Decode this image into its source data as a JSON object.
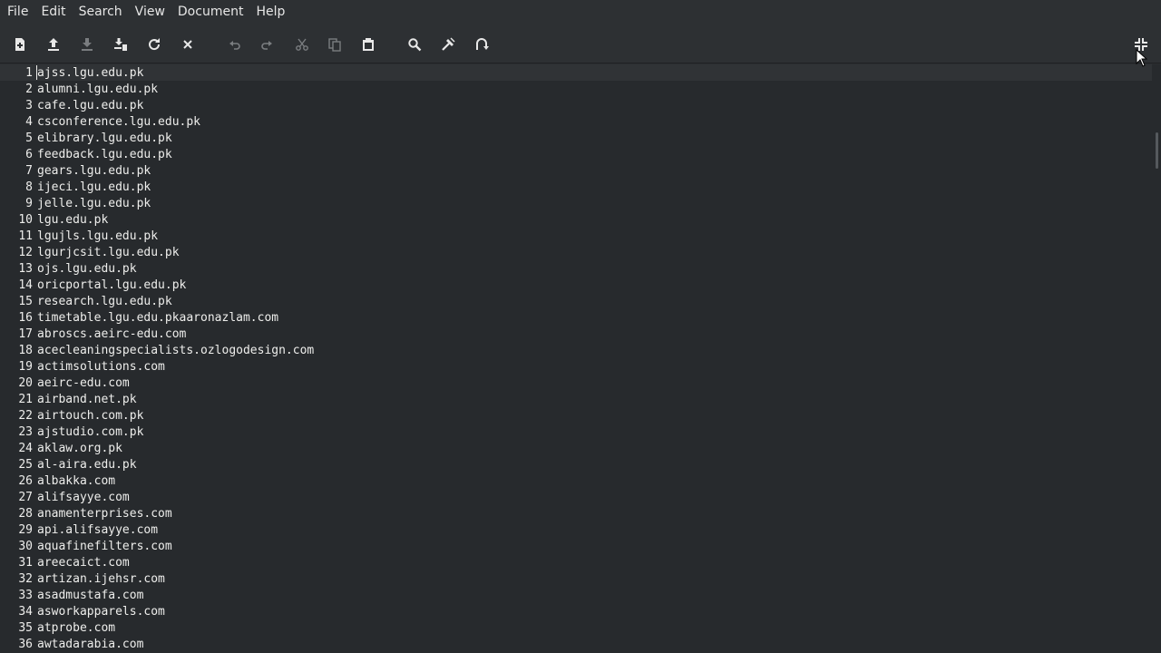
{
  "menubar": {
    "items": [
      "File",
      "Edit",
      "Search",
      "View",
      "Document",
      "Help"
    ]
  },
  "toolbar": {
    "buttons": [
      {
        "name": "new-document",
        "icon": "new-document-icon",
        "enabled": true
      },
      {
        "name": "open",
        "icon": "open-upload-icon",
        "enabled": true
      },
      {
        "name": "save",
        "icon": "save-download-icon",
        "enabled": false
      },
      {
        "name": "save-as",
        "icon": "save-as-icon",
        "enabled": true
      },
      {
        "name": "reload",
        "icon": "reload-icon",
        "enabled": true
      },
      {
        "name": "close",
        "icon": "close-icon",
        "enabled": true
      },
      {
        "name": "undo",
        "icon": "undo-icon",
        "enabled": false
      },
      {
        "name": "redo",
        "icon": "redo-icon",
        "enabled": false
      },
      {
        "name": "cut",
        "icon": "cut-icon",
        "enabled": false
      },
      {
        "name": "copy",
        "icon": "copy-icon",
        "enabled": false
      },
      {
        "name": "paste",
        "icon": "paste-icon",
        "enabled": true
      },
      {
        "name": "find",
        "icon": "search-icon",
        "enabled": true
      },
      {
        "name": "replace",
        "icon": "replace-icon",
        "enabled": true
      },
      {
        "name": "goto",
        "icon": "goto-icon",
        "enabled": true
      },
      {
        "name": "leave-fullscreen",
        "icon": "leave-fullscreen-icon",
        "enabled": true
      }
    ]
  },
  "editor": {
    "current_line": 1,
    "lines": [
      {
        "number": "1",
        "text": "ajss.lgu.edu.pk"
      },
      {
        "number": "2",
        "text": "alumni.lgu.edu.pk"
      },
      {
        "number": "3",
        "text": "cafe.lgu.edu.pk"
      },
      {
        "number": "4",
        "text": "csconference.lgu.edu.pk"
      },
      {
        "number": "5",
        "text": "elibrary.lgu.edu.pk"
      },
      {
        "number": "6",
        "text": "feedback.lgu.edu.pk"
      },
      {
        "number": "7",
        "text": "gears.lgu.edu.pk"
      },
      {
        "number": "8",
        "text": "ijeci.lgu.edu.pk"
      },
      {
        "number": "9",
        "text": "jelle.lgu.edu.pk"
      },
      {
        "number": "10",
        "text": "lgu.edu.pk"
      },
      {
        "number": "11",
        "text": "lgujls.lgu.edu.pk"
      },
      {
        "number": "12",
        "text": "lgurjcsit.lgu.edu.pk"
      },
      {
        "number": "13",
        "text": "ojs.lgu.edu.pk"
      },
      {
        "number": "14",
        "text": "oricportal.lgu.edu.pk"
      },
      {
        "number": "15",
        "text": "research.lgu.edu.pk"
      },
      {
        "number": "16",
        "text": "timetable.lgu.edu.pkaaronazlam.com"
      },
      {
        "number": "17",
        "text": "abroscs.aeirc-edu.com"
      },
      {
        "number": "18",
        "text": "acecleaningspecialists.ozlogodesign.com"
      },
      {
        "number": "19",
        "text": "actimsolutions.com"
      },
      {
        "number": "20",
        "text": "aeirc-edu.com"
      },
      {
        "number": "21",
        "text": "airband.net.pk"
      },
      {
        "number": "22",
        "text": "airtouch.com.pk"
      },
      {
        "number": "23",
        "text": "ajstudio.com.pk"
      },
      {
        "number": "24",
        "text": "aklaw.org.pk"
      },
      {
        "number": "25",
        "text": "al-aira.edu.pk"
      },
      {
        "number": "26",
        "text": "albakka.com"
      },
      {
        "number": "27",
        "text": "alifsayye.com"
      },
      {
        "number": "28",
        "text": "anamenterprises.com"
      },
      {
        "number": "29",
        "text": "api.alifsayye.com"
      },
      {
        "number": "30",
        "text": "aquafinefilters.com"
      },
      {
        "number": "31",
        "text": "areecaict.com"
      },
      {
        "number": "32",
        "text": "artizan.ijehsr.com"
      },
      {
        "number": "33",
        "text": "asadmustafa.com"
      },
      {
        "number": "34",
        "text": "asworkapparels.com"
      },
      {
        "number": "35",
        "text": "atprobe.com"
      },
      {
        "number": "36",
        "text": "awtadarabia.com"
      }
    ]
  },
  "colors": {
    "background": "#272a2d",
    "chrome": "#2d3033",
    "text": "#eeeeec",
    "icon_enabled": "#e8e8e8",
    "icon_disabled": "#7a7d80"
  }
}
